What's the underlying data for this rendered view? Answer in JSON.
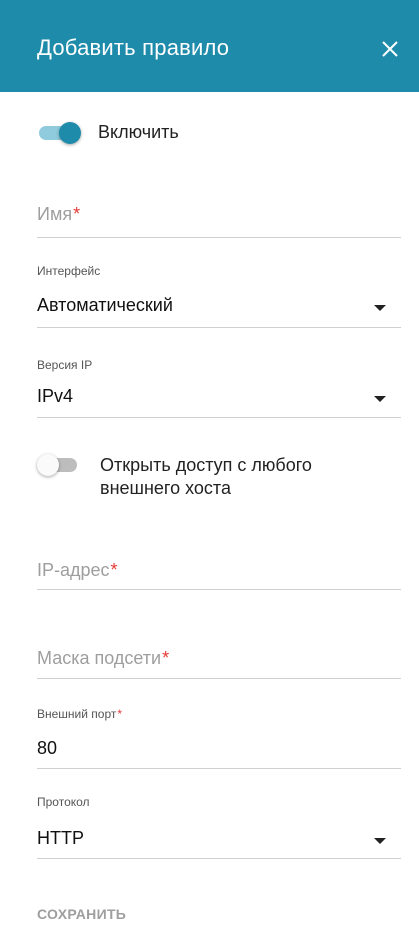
{
  "dialog": {
    "title": "Добавить правило",
    "close_icon": "close-icon",
    "accent_color": "#1f8bab"
  },
  "enable": {
    "label": "Включить",
    "state": true
  },
  "name_field": {
    "placeholder": "Имя",
    "required_mark": "*",
    "value": ""
  },
  "interface_field": {
    "label": "Интерфейс",
    "value": "Автоматический"
  },
  "ip_version_field": {
    "label": "Версия IP",
    "value": "IPv4"
  },
  "open_access": {
    "label_line1": "Открыть доступ с любого",
    "label_line2": "внешнего хоста",
    "state": false
  },
  "ip_field": {
    "placeholder": "IP-адрес",
    "required_mark": "*",
    "value": ""
  },
  "mask_field": {
    "placeholder": "Маска подсети",
    "required_mark": "*",
    "value": ""
  },
  "external_port_field": {
    "label": "Внешний порт",
    "required_mark": "*",
    "value": "80"
  },
  "protocol_field": {
    "label": "Протокол",
    "value": "HTTP"
  },
  "footer": {
    "save_label": "СОХРАНИТЬ"
  }
}
